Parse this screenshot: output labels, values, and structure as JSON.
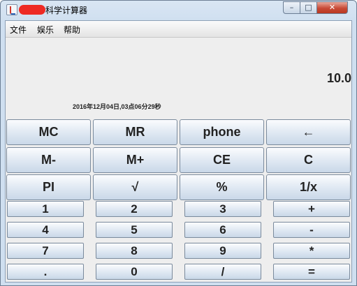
{
  "window": {
    "title": "科学计算器",
    "minimize_glyph": "–",
    "maximize_glyph": "□",
    "close_glyph": "✕"
  },
  "menu": [
    "文件",
    "娱乐",
    "帮助"
  ],
  "display": {
    "value": "10.0",
    "datetime": "2016年12月04日,03点06分29秒"
  },
  "buttons": {
    "row1": [
      "MC",
      "MR",
      "phone",
      "←"
    ],
    "row2": [
      "M-",
      "M+",
      "CE",
      "C"
    ],
    "row3": [
      "PI",
      "√",
      "%",
      "1/x"
    ],
    "row4": [
      "1",
      "2",
      "3",
      "+"
    ],
    "row5": [
      "4",
      "5",
      "6",
      "-"
    ],
    "row6": [
      "7",
      "8",
      "9",
      "*"
    ],
    "row7": [
      ".",
      "0",
      "/",
      "="
    ]
  },
  "icons": {
    "app": "java-app-icon"
  },
  "colors": {
    "titlebar": "#cfdff0",
    "close_button": "#c84a36",
    "client_background": "#eeeeee",
    "button_gradient_top": "#fbfcfe",
    "button_gradient_bottom": "#c9d8e8"
  }
}
